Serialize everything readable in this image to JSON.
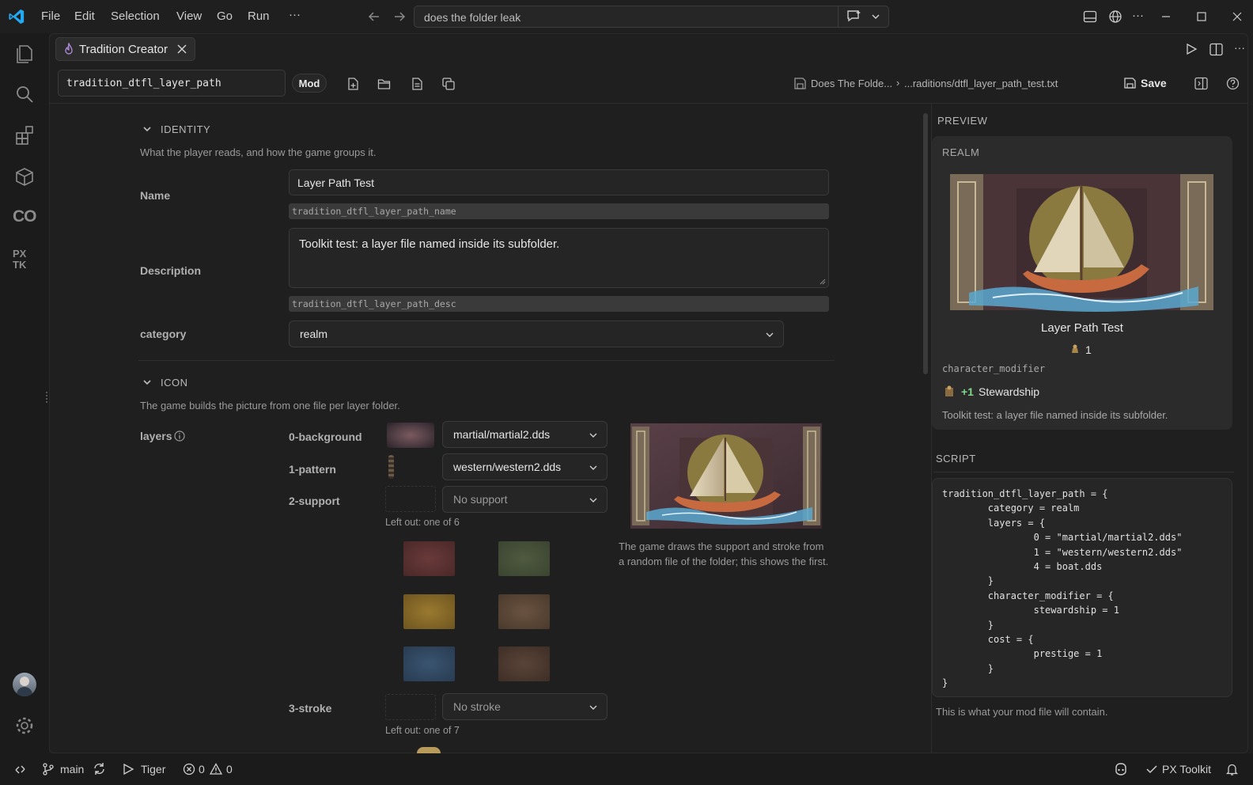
{
  "menu": {
    "file": "File",
    "edit": "Edit",
    "selection": "Selection",
    "view": "View",
    "go": "Go",
    "run": "Run",
    "more": "···"
  },
  "search": {
    "text": "does the folder leak"
  },
  "tab": {
    "label": "Tradition Creator"
  },
  "toolbar": {
    "id_value": "tradition_dtfl_layer_path",
    "mod_label": "Mod",
    "breadcrumb_folder": "Does The Folde...",
    "breadcrumb_sep": "›",
    "breadcrumb_file": "...raditions/dtfl_layer_path_test.txt",
    "save_label": "Save"
  },
  "identity": {
    "heading": "IDENTITY",
    "hint": "What the player reads, and how the game groups it.",
    "name_label": "Name",
    "name_value": "Layer Path Test",
    "name_key": "tradition_dtfl_layer_path_name",
    "desc_label": "Description",
    "desc_value": "Toolkit test: a layer file named inside its subfolder.",
    "desc_key": "tradition_dtfl_layer_path_desc",
    "category_label": "category",
    "category_value": "realm"
  },
  "icon": {
    "heading": "ICON",
    "hint": "The game builds the picture from one file per layer folder.",
    "layers_label": "layers",
    "layers": [
      {
        "label": "0-background",
        "value": "martial/martial2.dds"
      },
      {
        "label": "1-pattern",
        "value": "western/western2.dds"
      },
      {
        "label": "2-support",
        "value": "No support",
        "note": "Left out: one of 6"
      },
      {
        "label": "3-stroke",
        "value": "No stroke",
        "note": "Left out: one of 7"
      }
    ],
    "preview_note": "The game draws the support and stroke from a random file of the folder; this shows the first.",
    "swatch_colors": [
      "#5a2e2e",
      "#3f4a34",
      "#8a6a22",
      "#5a4530",
      "#2e4560",
      "#4e3a30"
    ]
  },
  "preview": {
    "heading": "PREVIEW",
    "category_tag": "REALM",
    "title": "Layer Path Test",
    "cost": "1",
    "modifier_key": "character_modifier",
    "modifier_value": "+1",
    "modifier_name": "Stewardship",
    "description": "Toolkit test: a layer file named inside its subfolder."
  },
  "script": {
    "heading": "SCRIPT",
    "code": "tradition_dtfl_layer_path = {\n        category = realm\n        layers = {\n                0 = \"martial/martial2.dds\"\n                1 = \"western/western2.dds\"\n                4 = boat.dds\n        }\n        character_modifier = {\n                stewardship = 1\n        }\n        cost = {\n                prestige = 1\n        }\n}",
    "footer": "This is what your mod file will contain."
  },
  "status": {
    "branch": "main",
    "run_target": "Tiger",
    "errors": "0",
    "warnings": "0",
    "extension": "PX Toolkit"
  },
  "colors": {
    "accent": "#3794ff",
    "vscode_blue": "#23a9f2",
    "green": "#7fd88c",
    "panel": "#2b2b2b"
  }
}
